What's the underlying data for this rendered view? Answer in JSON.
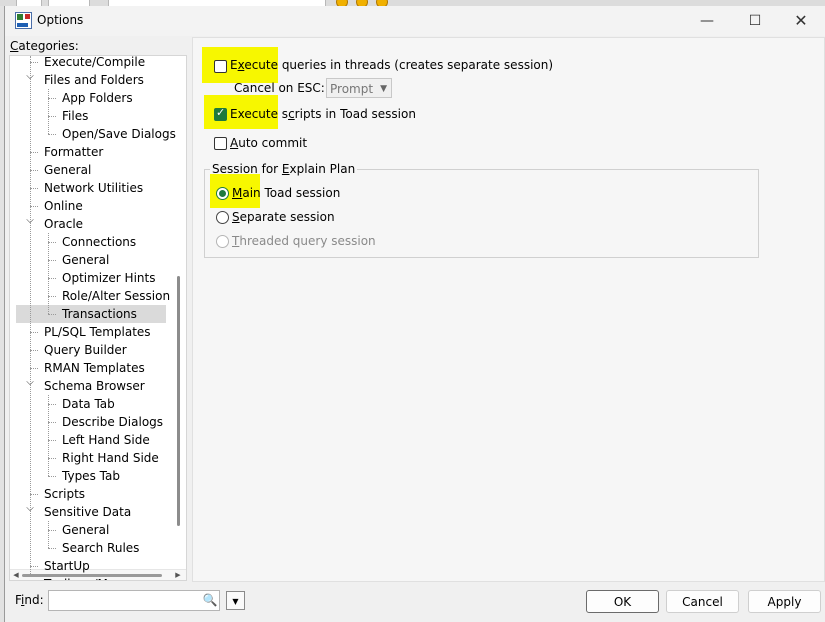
{
  "window": {
    "title": "Options"
  },
  "tree": {
    "header_pre": "",
    "header_underline": "C",
    "header_rest": "ategories:",
    "items": [
      {
        "label": "Execute/Compile",
        "level": 1,
        "expander": "",
        "partial": true
      },
      {
        "label": "Files and Folders",
        "level": 1,
        "expander": "v"
      },
      {
        "label": "App Folders",
        "level": 2,
        "expander": ""
      },
      {
        "label": "Files",
        "level": 2,
        "expander": ""
      },
      {
        "label": "Open/Save Dialogs",
        "level": 2,
        "expander": ""
      },
      {
        "label": "Formatter",
        "level": 1,
        "expander": ""
      },
      {
        "label": "General",
        "level": 1,
        "expander": ""
      },
      {
        "label": "Network Utilities",
        "level": 1,
        "expander": ""
      },
      {
        "label": "Online",
        "level": 1,
        "expander": ""
      },
      {
        "label": "Oracle",
        "level": 1,
        "expander": "v"
      },
      {
        "label": "Connections",
        "level": 2,
        "expander": ""
      },
      {
        "label": "General",
        "level": 2,
        "expander": ""
      },
      {
        "label": "Optimizer Hints",
        "level": 2,
        "expander": ""
      },
      {
        "label": "Role/Alter Session",
        "level": 2,
        "expander": ""
      },
      {
        "label": "Transactions",
        "level": 2,
        "expander": "",
        "selected": true
      },
      {
        "label": "PL/SQL Templates",
        "level": 1,
        "expander": ""
      },
      {
        "label": "Query Builder",
        "level": 1,
        "expander": ""
      },
      {
        "label": "RMAN Templates",
        "level": 1,
        "expander": ""
      },
      {
        "label": "Schema Browser",
        "level": 1,
        "expander": "v"
      },
      {
        "label": "Data Tab",
        "level": 2,
        "expander": ""
      },
      {
        "label": "Describe Dialogs",
        "level": 2,
        "expander": ""
      },
      {
        "label": "Left Hand Side",
        "level": 2,
        "expander": ""
      },
      {
        "label": "Right Hand Side",
        "level": 2,
        "expander": ""
      },
      {
        "label": "Types Tab",
        "level": 2,
        "expander": ""
      },
      {
        "label": "Scripts",
        "level": 1,
        "expander": ""
      },
      {
        "label": "Sensitive Data",
        "level": 1,
        "expander": "v"
      },
      {
        "label": "General",
        "level": 2,
        "expander": ""
      },
      {
        "label": "Search Rules",
        "level": 2,
        "expander": ""
      },
      {
        "label": "StartUp",
        "level": 1,
        "expander": ""
      },
      {
        "label": "Toolbars/Menus",
        "level": 1,
        "expander": "",
        "partial": true
      }
    ]
  },
  "settings": {
    "exec_threads": {
      "label_pre": "E",
      "label_underline": "x",
      "label_rest": "ecute queries in threads (creates separate session)",
      "checked": false,
      "highlighted": true
    },
    "cancel_on_esc": {
      "label": "Cancel on ESC:",
      "value": "Prompt"
    },
    "exec_scripts": {
      "label_pre": "Execute s",
      "label_underline": "c",
      "label_rest": "ripts in Toad session",
      "checked": true,
      "highlighted": true
    },
    "auto_commit": {
      "label_pre": "",
      "label_underline": "A",
      "label_rest": "uto commit",
      "checked": false
    },
    "explain_plan": {
      "title_pre": "Session for ",
      "title_underline": "E",
      "title_rest": "xplain Plan",
      "options": [
        {
          "label_pre": "",
          "label_underline": "M",
          "label_rest": "ain Toad session",
          "selected": true,
          "disabled": false
        },
        {
          "label_pre": "",
          "label_underline": "S",
          "label_rest": "eparate session",
          "selected": false,
          "disabled": false
        },
        {
          "label_pre": "",
          "label_underline": "T",
          "label_rest": "hreaded query session",
          "selected": false,
          "disabled": true
        }
      ]
    }
  },
  "footer": {
    "find_pre": "F",
    "find_underline": "i",
    "find_rest": "nd:",
    "find_value": "",
    "ok_label": "OK",
    "cancel_label": "Cancel",
    "apply_label": "Apply"
  },
  "colors": {
    "highlight": "#f7f700",
    "check_green": "#1f7a3d",
    "selected_row": "#dadada"
  }
}
